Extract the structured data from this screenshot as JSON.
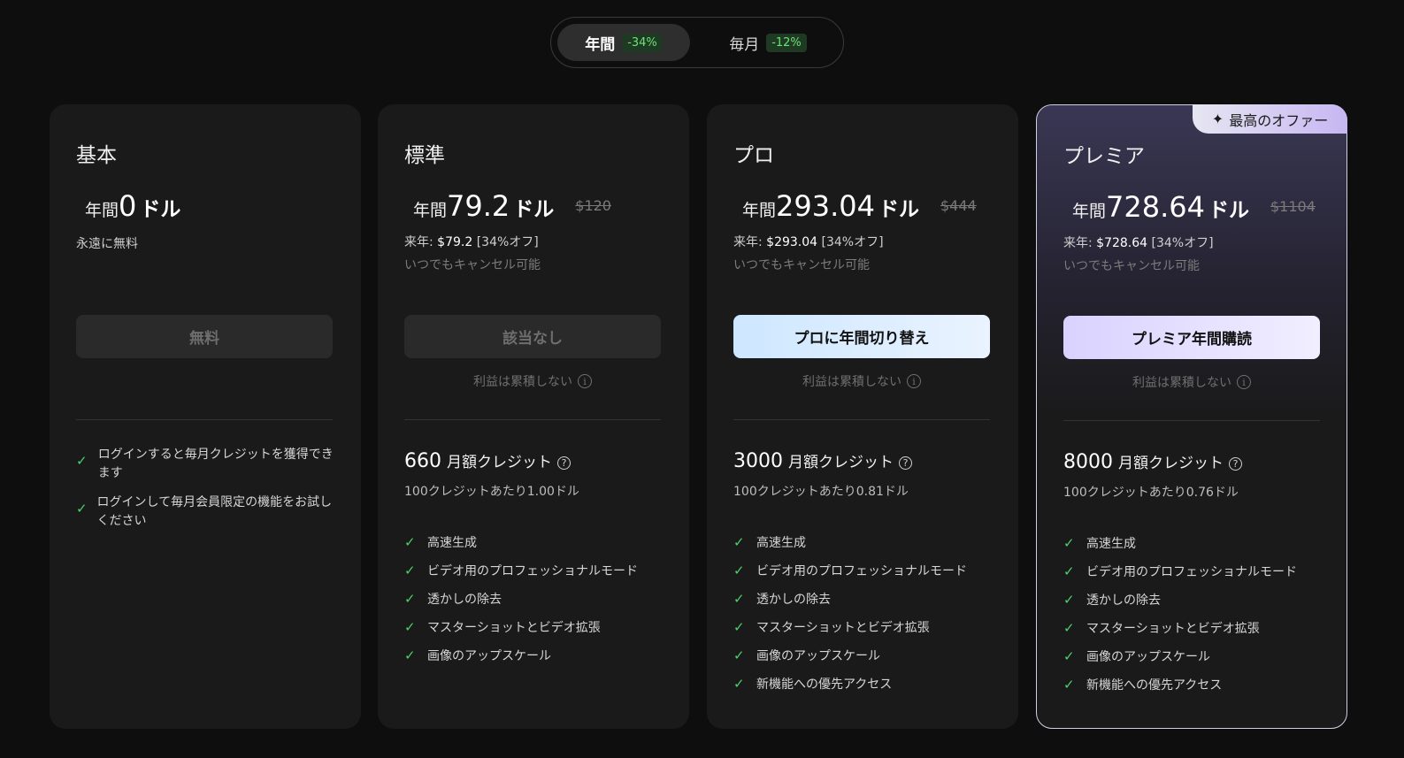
{
  "toggle": {
    "yearly_label": "年間",
    "yearly_badge": "-34%",
    "monthly_label": "毎月",
    "monthly_badge": "-12%"
  },
  "common": {
    "cancel_note": "いつでもキャンセル可能",
    "no_accum": "利益は累積しない",
    "credits_label": "月額クレジット",
    "price_prefix": "年間",
    "price_unit": "ドル"
  },
  "plans": {
    "basic": {
      "title": "基本",
      "price": "0",
      "note": "永遠に無料",
      "cta": "無料",
      "features": [
        "ログインすると毎月クレジットを獲得できます",
        "ログインして毎月会員限定の機能をお試しください"
      ]
    },
    "standard": {
      "title": "標準",
      "price": "79.2",
      "old_price": "$120",
      "next_year_label": "来年:",
      "next_year_price": "$79.2",
      "next_year_discount": "[34%オフ]",
      "cta": "該当なし",
      "credits": "660",
      "rate": "100クレジットあたり1.00ドル",
      "features": [
        "高速生成",
        "ビデオ用のプロフェッショナルモード",
        "透かしの除去",
        "マスターショットとビデオ拡張",
        "画像のアップスケール"
      ]
    },
    "pro": {
      "title": "プロ",
      "price": "293.04",
      "old_price": "$444",
      "next_year_label": "来年:",
      "next_year_price": "$293.04",
      "next_year_discount": "[34%オフ]",
      "cta": "プロに年間切り替え",
      "credits": "3000",
      "rate": "100クレジットあたり0.81ドル",
      "features": [
        "高速生成",
        "ビデオ用のプロフェッショナルモード",
        "透かしの除去",
        "マスターショットとビデオ拡張",
        "画像のアップスケール",
        "新機能への優先アクセス"
      ]
    },
    "premium": {
      "title": "プレミア",
      "ribbon": "最高のオファー",
      "price": "728.64",
      "old_price": "$1104",
      "next_year_label": "来年:",
      "next_year_price": "$728.64",
      "next_year_discount": "[34%オフ]",
      "cta": "プレミア年間購読",
      "credits": "8000",
      "rate": "100クレジットあたり0.76ドル",
      "features": [
        "高速生成",
        "ビデオ用のプロフェッショナルモード",
        "透かしの除去",
        "マスターショットとビデオ拡張",
        "画像のアップスケール",
        "新機能への優先アクセス"
      ]
    }
  }
}
